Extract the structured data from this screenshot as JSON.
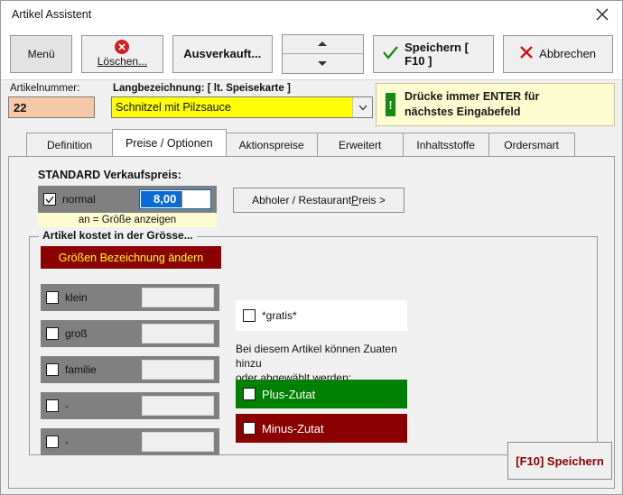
{
  "window": {
    "title": "Artikel Assistent",
    "close_icon": "close-icon"
  },
  "toolbar": {
    "menu_label": "Menü",
    "delete_label": "Löschen...",
    "delete_icon": "delete-circle-icon",
    "soldout_label": "Ausverkauft...",
    "spinner_up_icon": "triangle-up-icon",
    "spinner_down_icon": "triangle-down-icon",
    "save_label": "Speichern [ F10 ]",
    "save_icon": "check-icon",
    "cancel_label": "Abbrechen",
    "cancel_icon": "x-icon"
  },
  "fields": {
    "artikelnummer_label": "Artikelnummer:",
    "artikelnummer_value": "22",
    "langbezeichnung_label": "Langbezeichnung:  [ lt. Speisekarte ]",
    "langbezeichnung_value": "Schnitzel mit Pilzsauce",
    "dropdown_icon": "chevron-down-icon"
  },
  "hint": {
    "icon": "exclamation-icon",
    "icon_glyph": "!",
    "line1": "Drücke immer ENTER für",
    "line2": "nächstes Eingabefeld"
  },
  "tabs": [
    {
      "label": "Definition",
      "active": false
    },
    {
      "label": "Preise / Optionen",
      "active": true
    },
    {
      "label": "Aktionspreise",
      "active": false
    },
    {
      "label": "Erweitert",
      "active": false
    },
    {
      "label": "Inhaltsstoffe",
      "active": false
    },
    {
      "label": "Ordersmart",
      "active": false
    }
  ],
  "pricing": {
    "section_title": "STANDARD Verkaufspreis:",
    "normal_label": "normal",
    "normal_checked": true,
    "price_value": "8,00",
    "note": "an = Größe anzeigen",
    "abholer_pre": "Abholer / Restaurant ",
    "abholer_underline": "P",
    "abholer_post": "reis >"
  },
  "sizes": {
    "legend": "Artikel kostet in der Grösse...",
    "rename_button": "Größen Bezeichnung ändern",
    "rows": [
      {
        "label": "klein",
        "value": ""
      },
      {
        "label": "groß",
        "value": ""
      },
      {
        "label": "familie",
        "value": ""
      },
      {
        "label": "-",
        "value": ""
      },
      {
        "label": "-",
        "value": ""
      }
    ]
  },
  "options": {
    "gratis_label": "*gratis*",
    "zutat_note_line1": "Bei diesem Artikel können Zuaten hinzu",
    "zutat_note_line2": "oder abgewählt werden:",
    "plus_label": "Plus-Zutat",
    "minus_label": "Minus-Zutat"
  },
  "footer": {
    "f10_label": "[F10] Speichern"
  },
  "colors": {
    "accent_yellow": "#ffff00",
    "artnr_bg": "#f5c8a8",
    "hint_bg": "#fdfbd0",
    "row_gray": "#808080",
    "dark_red": "#8b0000",
    "green": "#008000",
    "selection_blue": "#0a6bd6"
  }
}
